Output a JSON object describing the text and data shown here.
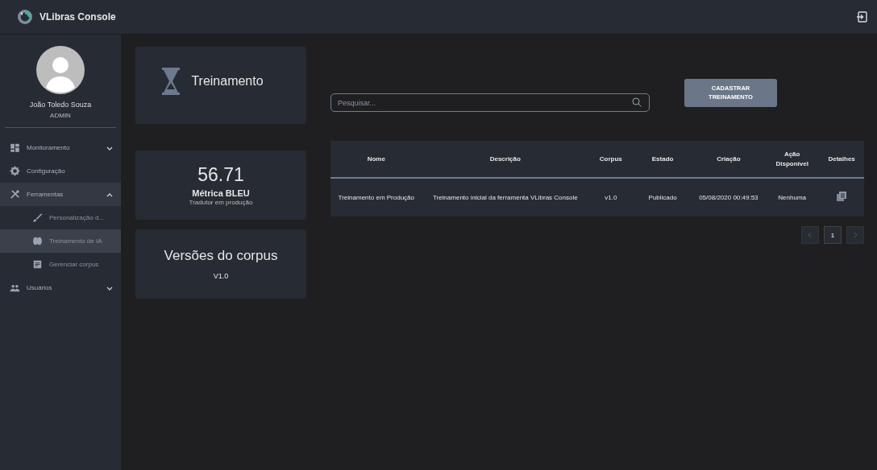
{
  "app_bar": {
    "title": "VLibras Console"
  },
  "user": {
    "name": "João Toledo Souza",
    "role": "ADMIN"
  },
  "nav": [
    {
      "label": "Monitoramento",
      "expanded": false,
      "selected": false
    },
    {
      "label": "Configuração",
      "selected": false
    },
    {
      "label": "Ferramentas",
      "expanded": true,
      "selected": true,
      "children": [
        {
          "label": "Personalização d...",
          "selected": false
        },
        {
          "label": "Treinamento de IA",
          "selected": true
        },
        {
          "label": "Gerenciar corpus",
          "selected": false
        }
      ]
    },
    {
      "label": "Usuários",
      "expanded": false,
      "selected": false
    }
  ],
  "header_card": {
    "title": "Treinamento"
  },
  "metric_card": {
    "value": "56.71",
    "label": "Métrica BLEU",
    "caption": "Tradutor em produção"
  },
  "corpus_card": {
    "title": "Versões do corpus",
    "version": "V1.0"
  },
  "search": {
    "placeholder": "Pesquisar..."
  },
  "register_button": "CADASTRAR TREINAMENTO",
  "table": {
    "columns": [
      "Nome",
      "Descrição",
      "Corpus",
      "Estado",
      "Criação",
      "Ação Disponível",
      "Detalhes"
    ],
    "rows": [
      {
        "cells": [
          "Treinamento em Produção",
          "Treinamento inicial da ferramenta VLibras Console",
          "v1.0",
          "Publicado",
          "05/08/2020 00:49:53",
          "Nenhuma"
        ]
      }
    ]
  },
  "pagination": {
    "pages": [
      {
        "label": "1",
        "selected": true
      }
    ]
  }
}
